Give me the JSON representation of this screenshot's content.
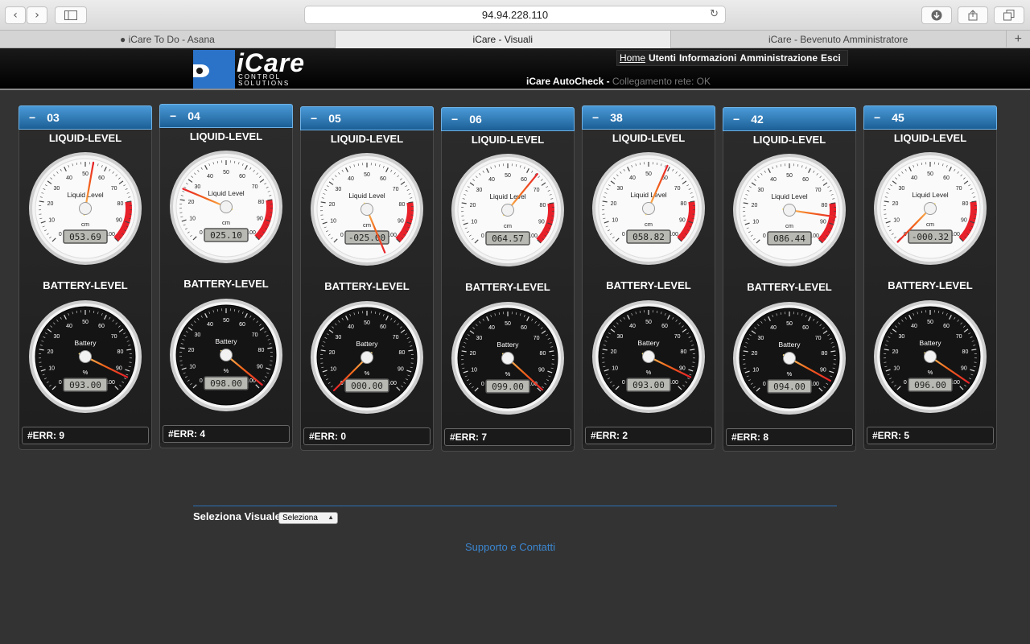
{
  "browser": {
    "address": "94.94.228.110",
    "tabs": [
      {
        "label": "● iCare To Do - Asana"
      },
      {
        "label": "iCare - Visuali"
      },
      {
        "label": "iCare - Bevenuto Amministratore"
      }
    ]
  },
  "header": {
    "logo_title": "iCare",
    "logo_sub_1": "CONTROL",
    "logo_sub_2": "SOLUTIONS",
    "nav": [
      "Home",
      "Utenti",
      "Informazioni",
      "Amministrazione",
      "Esci"
    ],
    "status_label": "iCare AutoCheck -",
    "status_value": "Collegamento rete: OK"
  },
  "labels": {
    "liquid": "LIQUID-LEVEL",
    "battery": "BATTERY-LEVEL",
    "liquid_gauge_title": "Liquid Level",
    "liquid_unit": "cm",
    "battery_gauge_title": "Battery",
    "battery_unit": "%",
    "collapse": "−",
    "ticks": [
      "0",
      "10",
      "20",
      "30",
      "40",
      "50",
      "60",
      "70",
      "80",
      "90",
      "100"
    ]
  },
  "panels": [
    {
      "id": "03",
      "liquid": 53.69,
      "liquid_text": "053.69",
      "battery": 93.0,
      "battery_text": "093.00",
      "err": "#ERR: 9"
    },
    {
      "id": "04",
      "liquid": 25.1,
      "liquid_text": "025.10",
      "battery": 98.0,
      "battery_text": "098.00",
      "err": "#ERR: 4"
    },
    {
      "id": "05",
      "liquid": -25.0,
      "liquid_text": "-025.00",
      "battery": 0.0,
      "battery_text": "000.00",
      "err": "#ERR: 0"
    },
    {
      "id": "06",
      "liquid": 64.57,
      "liquid_text": "064.57",
      "battery": 99.0,
      "battery_text": "099.00",
      "err": "#ERR: 7"
    },
    {
      "id": "38",
      "liquid": 58.82,
      "liquid_text": "058.82",
      "battery": 93.0,
      "battery_text": "093.00",
      "err": "#ERR: 2"
    },
    {
      "id": "42",
      "liquid": 86.44,
      "liquid_text": "086.44",
      "battery": 94.0,
      "battery_text": "094.00",
      "err": "#ERR: 8"
    },
    {
      "id": "45",
      "liquid": -0.32,
      "liquid_text": "-000.32",
      "battery": 96.0,
      "battery_text": "096.00",
      "err": "#ERR: 5"
    }
  ],
  "footer": {
    "select_label": "Seleziona Visuale:",
    "select_value": "Seleziona",
    "support": "Supporto e Contatti"
  },
  "colors": {
    "accent": "#2c6fb6",
    "danger": "#e8202a",
    "needle": "#f26a1b"
  }
}
